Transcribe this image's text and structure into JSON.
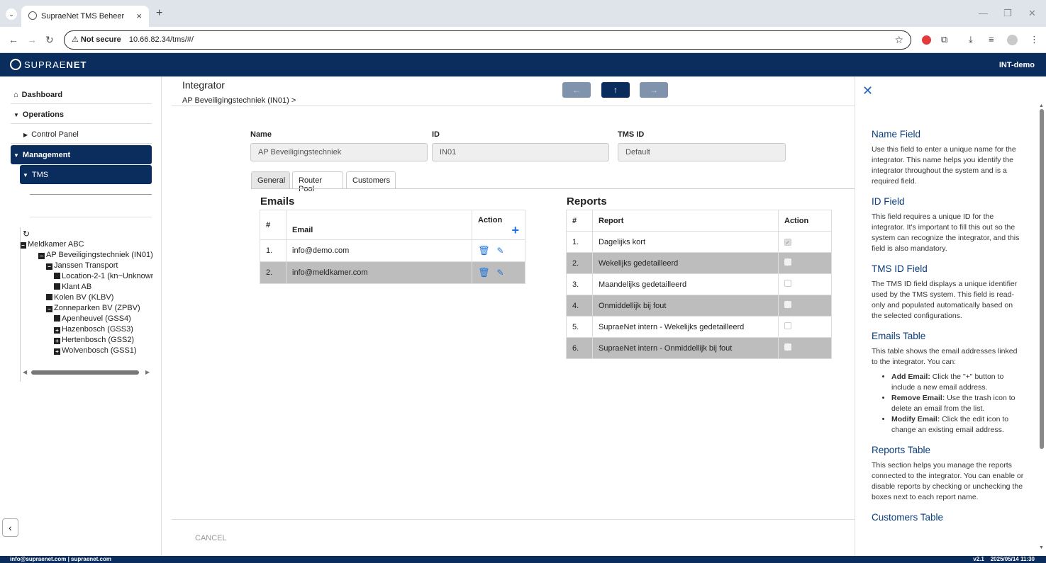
{
  "browser": {
    "tab_title": "SupraeNet TMS Beheer",
    "tab_close": "×",
    "new_tab": "+",
    "security_label": "Not secure",
    "url": "10.66.82.34/tms/#/"
  },
  "app": {
    "logo_light": "SUPRAE",
    "logo_bold": "NET",
    "environment": "INT-demo"
  },
  "sidebar": {
    "dashboard": "Dashboard",
    "operations": "Operations",
    "control_panel": "Control Panel",
    "management": "Management",
    "tms": "TMS",
    "tree": {
      "refresh": "↻",
      "nodes": [
        {
          "label": "Meldkamer ABC",
          "marker": "−"
        },
        {
          "label": "AP Beveiligingstechniek (IN01)",
          "marker": "−"
        },
        {
          "label": "Janssen Transport",
          "marker": "−"
        },
        {
          "label": "Location-2-1 (kn~Unknown",
          "marker": ""
        },
        {
          "label": "Klant AB",
          "marker": ""
        },
        {
          "label": "Kolen BV (KLBV)",
          "marker": ""
        },
        {
          "label": "Zonneparken BV (ZPBV)",
          "marker": "−"
        },
        {
          "label": "Apenheuvel (GSS4)",
          "marker": ""
        },
        {
          "label": "Hazenbosch (GSS3)",
          "marker": "+"
        },
        {
          "label": "Hertenbosch (GSS2)",
          "marker": "+"
        },
        {
          "label": "Wolvenbosch (GSS1)",
          "marker": "+"
        }
      ]
    }
  },
  "main": {
    "title": "Integrator",
    "breadcrumb": "AP Beveiligingstechniek (IN01) >",
    "nav": {
      "prev": "←",
      "up": "↑",
      "next": "→"
    },
    "fields": {
      "name_label": "Name",
      "name_value": "AP Beveiligingstechniek",
      "id_label": "ID",
      "id_value": "IN01",
      "tmsid_label": "TMS ID",
      "tmsid_value": "Default"
    },
    "tabs": [
      "General",
      "Router Pool",
      "Customers"
    ],
    "emails": {
      "title": "Emails",
      "col_num": "#",
      "col_email": "Email",
      "col_action": "Action",
      "rows": [
        {
          "num": "1.",
          "email": "info@demo.com"
        },
        {
          "num": "2.",
          "email": "info@meldkamer.com"
        }
      ]
    },
    "reports": {
      "title": "Reports",
      "col_num": "#",
      "col_report": "Report",
      "col_action": "Action",
      "rows": [
        {
          "num": "1.",
          "report": "Dagelijks kort",
          "checked": true
        },
        {
          "num": "2.",
          "report": "Wekelijks gedetailleerd",
          "checked": false
        },
        {
          "num": "3.",
          "report": "Maandelijks gedetailleerd",
          "checked": false
        },
        {
          "num": "4.",
          "report": "Onmiddellijk bij fout",
          "checked": false
        },
        {
          "num": "5.",
          "report": "SupraeNet intern - Wekelijks gedetailleerd",
          "checked": false
        },
        {
          "num": "6.",
          "report": "SupraeNet intern - Onmiddellijk bij fout",
          "checked": false
        }
      ]
    },
    "cancel": "CANCEL"
  },
  "help": {
    "sections": {
      "name_title": "Name Field",
      "name_text": "Use this field to enter a unique name for the integrator. This name helps you identify the integrator throughout the system and is a required field.",
      "id_title": "ID Field",
      "id_text": "This field requires a unique ID for the integrator. It's important to fill this out so the system can recognize the integrator, and this field is also mandatory.",
      "tmsid_title": "TMS ID Field",
      "tmsid_text": "The TMS ID field displays a unique identifier used by the TMS system. This field is read-only and populated automatically based on the selected configurations.",
      "emails_title": "Emails Table",
      "emails_text": "This table shows the email addresses linked to the integrator. You can:",
      "emails_bullets": [
        {
          "bold": "Add Email:",
          "text": " Click the \"+\" button to include a new email address."
        },
        {
          "bold": "Remove Email:",
          "text": " Use the trash icon to delete an email from the list."
        },
        {
          "bold": "Modify Email:",
          "text": " Click the edit icon to change an existing email address."
        }
      ],
      "reports_title": "Reports Table",
      "reports_text": "This section helps you manage the reports connected to the integrator. You can enable or disable reports by checking or unchecking the boxes next to each report name.",
      "customers_title": "Customers Table"
    }
  },
  "status": {
    "left": "info@supraenet.com | supraenet.com",
    "version": "v2.1",
    "datetime": "2025/05/14 11:30"
  },
  "colors": {
    "brand_navy": "#0a2d5e",
    "accent_blue": "#1e73d9",
    "help_heading": "#0a3d7d"
  }
}
